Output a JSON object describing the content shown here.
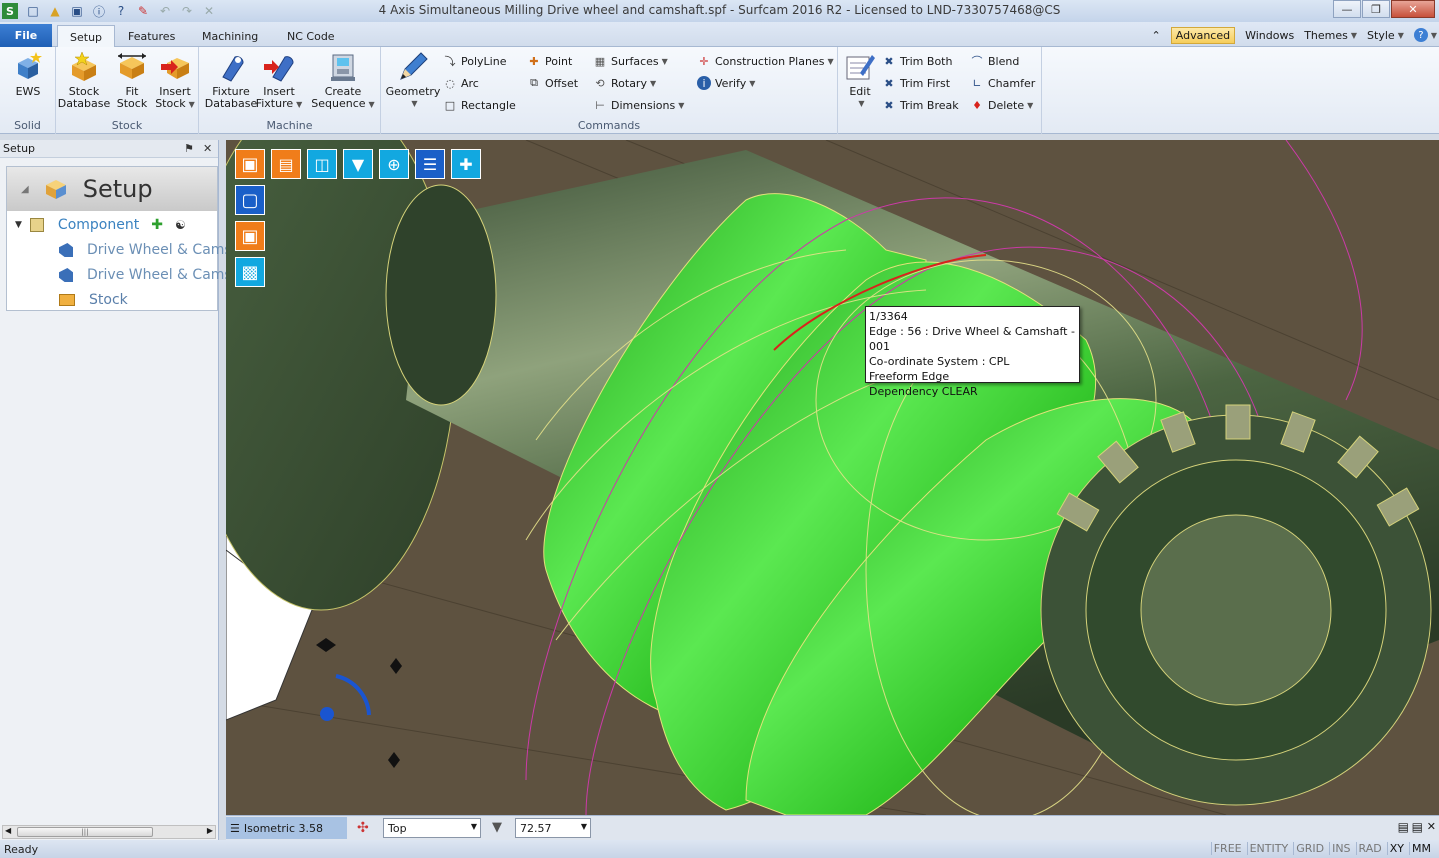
{
  "window": {
    "title": "4 Axis Simultaneous Milling Drive wheel and camshaft.spf - Surfcam 2016 R2  -  Licensed to LND-7330757468@CS",
    "app_logo": "S"
  },
  "ribbon_tabs": {
    "file": "File",
    "tabs": [
      "Setup",
      "Features",
      "Machining",
      "NC Code"
    ],
    "active": "Setup",
    "right": {
      "advanced": "Advanced",
      "windows": "Windows",
      "themes": "Themes",
      "style": "Style",
      "help": "?"
    }
  },
  "ribbon": {
    "solid": {
      "label": "Solid",
      "ews": "EWS"
    },
    "stock": {
      "label": "Stock",
      "database": [
        "Stock",
        "Database"
      ],
      "fit": [
        "Fit",
        "Stock"
      ],
      "insert": [
        "Insert",
        "Stock"
      ]
    },
    "machine": {
      "label": "Machine",
      "fixture_db": [
        "Fixture",
        "Database"
      ],
      "insert_fixture": [
        "Insert",
        "Fixture"
      ],
      "create_sequence": [
        "Create",
        "Sequence"
      ]
    },
    "commands": {
      "label": "Commands",
      "geometry": "Geometry",
      "polyline": "PolyLine",
      "arc": "Arc",
      "rectangle": "Rectangle",
      "point": "Point",
      "offset": "Offset",
      "surfaces": "Surfaces",
      "rotary": "Rotary",
      "dimensions": "Dimensions",
      "construction_planes": "Construction Planes",
      "verify": "Verify"
    },
    "edit": {
      "edit": "Edit",
      "trim_both": "Trim Both",
      "trim_first": "Trim First",
      "trim_break": "Trim Break",
      "blend": "Blend",
      "chamfer": "Chamfer",
      "delete": "Delete"
    }
  },
  "panel": {
    "title": "Setup",
    "tree_title": "Setup",
    "component": "Component",
    "items": [
      "Drive Wheel & Cams",
      "Drive Wheel & Cams"
    ],
    "stock": "Stock"
  },
  "tooltip": {
    "lines": [
      "1/3364",
      "Edge : 56 : Drive Wheel & Camshaft - 001",
      "Co-ordinate System : CPL",
      "Freeform Edge",
      "Dependency CLEAR"
    ]
  },
  "viewbar": {
    "view_name": "Isometric 3.58",
    "plane": "Top",
    "zoom": "72.57"
  },
  "status": {
    "text": "Ready",
    "flags": [
      "FREE",
      "ENTITY",
      "GRID",
      "INS",
      "RAD",
      "XY",
      "MM"
    ]
  },
  "colors": {
    "accent_green": "#22c41c",
    "viewport_bg": "#5e5240",
    "tool_orange": "#f07d1a",
    "tool_cyan": "#12a8e0"
  }
}
